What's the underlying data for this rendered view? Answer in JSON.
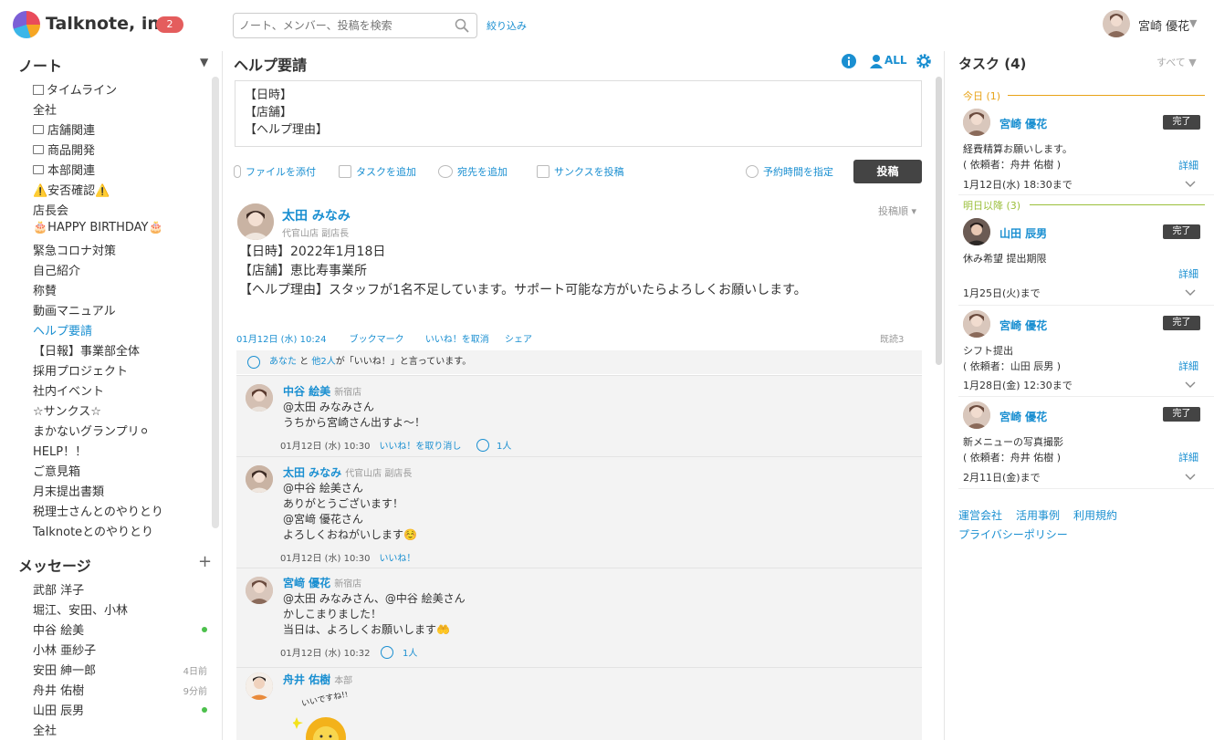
{
  "header": {
    "company": "Talknote, inc.",
    "badge": "2",
    "search_placeholder": "ノート、メンバー、投稿を検索",
    "filter": "絞り込み",
    "user_name": "宮崎 優花",
    "user_caret": "▼"
  },
  "sidebar": {
    "notes_title": "ノート",
    "notes_toggle": "▼",
    "notes": [
      {
        "label": "タイムライン"
      },
      {
        "label": "全社"
      },
      {
        "label": "店舗関連"
      },
      {
        "label": "商品開発"
      },
      {
        "label": "本部関連"
      },
      {
        "label": "⚠️安否確認⚠️"
      },
      {
        "label": "店長会"
      },
      {
        "label": "🎂HAPPY BIRTHDAY🎂"
      },
      {
        "label": "緊急コロナ対策"
      },
      {
        "label": "自己紹介"
      },
      {
        "label": "称賛"
      },
      {
        "label": "動画マニュアル"
      },
      {
        "label": "ヘルプ要請"
      },
      {
        "label": "【日報】事業部全体"
      },
      {
        "label": "採用プロジェクト"
      },
      {
        "label": "社内イベント"
      },
      {
        "label": "☆サンクス☆"
      },
      {
        "label": "まかないグランプリ⚪"
      },
      {
        "label": "HELP！！"
      },
      {
        "label": "ご意見箱"
      },
      {
        "label": "月末提出書類"
      },
      {
        "label": "税理士さんとのやりとり"
      },
      {
        "label": "Talknoteとのやりとり"
      }
    ],
    "messages_title": "メッセージ",
    "messages_add": "+",
    "messages": [
      {
        "label": "武部 洋子",
        "time": ""
      },
      {
        "label": "堀江、安田、小林",
        "time": ""
      },
      {
        "label": "中谷 絵美",
        "time": ""
      },
      {
        "label": "小林 亜紗子",
        "time": ""
      },
      {
        "label": "安田 紳一郎",
        "time": "4日前"
      },
      {
        "label": "舟井 佑樹",
        "time": "9分前"
      },
      {
        "label": "山田 辰男",
        "time": ""
      },
      {
        "label": "全社",
        "time": ""
      }
    ]
  },
  "center": {
    "title": "ヘルプ要請",
    "all_label": "ALL",
    "compose_text": "【日時】\n【店舗】\n【ヘルプ理由】",
    "toolbar": {
      "attach": "ファイルを添付",
      "task": "タスクを追加",
      "recipient": "宛先を追加",
      "thanks": "サンクスを投稿",
      "schedule": "予約時間を指定",
      "post": "投稿"
    },
    "post": {
      "author": "太田 みなみ",
      "author_sub": "代官山店 副店長",
      "order": "投稿順 ▾",
      "body": "【日時】2022年1月18日\n【店舗】恵比寿事業所\n【ヘルプ理由】スタッフが1名不足しています。サポート可能な方がいたらよろしくお願いします。",
      "date": "01月12日 (水) 10:24",
      "bookmark": "ブックマーク",
      "unlike": "いいね！を取消",
      "share": "シェア",
      "read": "既読3",
      "likes_you": "あなた",
      "likes_and": " と ",
      "likes_others": "他2人",
      "likes_tail": "が「いいね！」と言っています。"
    },
    "comments": [
      {
        "author": "中谷 絵美",
        "sub": "新宿店",
        "text": "@太田 みなみさん\nうちから宮崎さん出すよ〜！",
        "date": "01月12日 (水) 10:30",
        "action": "いいね！を取り消し",
        "likes": "1人"
      },
      {
        "author": "太田 みなみ",
        "sub": "代官山店 副店長",
        "text": "@中谷 絵美さん\nありがとうございます！\n@宮﨑 優花さん\nよろしくおねがいします☺️",
        "date": "01月12日 (水) 10:30",
        "action": "いいね！",
        "likes": ""
      },
      {
        "author": "宮﨑 優花",
        "sub": "新宿店",
        "text": "@太田 みなみさん、@中谷 絵美さん\nかしこまりました！\n当日は、よろしくお願いします🤲",
        "date": "01月12日 (水) 10:32",
        "action": "",
        "likes": "1人"
      },
      {
        "author": "舟井 佑樹",
        "sub": "本部",
        "text": "",
        "date": "",
        "action": "",
        "likes": "",
        "sticker_text": "いいですね!!"
      }
    ]
  },
  "tasks": {
    "title": "タスク (4)",
    "filter": "すべて ▼",
    "today_label": "今日 (1)",
    "later_label": "明日以降 (3)",
    "done_label": "完了",
    "detail_label": "詳細",
    "today_color": "#e8a317",
    "later_color": "#9bbf3b",
    "items": [
      {
        "name": "宮崎 優花",
        "desc": "経費精算お願いします。\n( 依頼者：舟井 佑樹 )",
        "due": "1月12日(水) 18:30まで"
      },
      {
        "name": "山田 辰男",
        "desc": "休み希望 提出期限",
        "due": "1月25日(火)まで"
      },
      {
        "name": "宮崎 優花",
        "desc": "シフト提出\n( 依頼者：山田 辰男 )",
        "due": "1月28日(金) 12:30まで"
      },
      {
        "name": "宮崎 優花",
        "desc": "新メニューの写真撮影\n( 依頼者：舟井 佑樹 )",
        "due": "2月11日(金)まで"
      }
    ],
    "footer": {
      "company": "運営会社",
      "examples": "活用事例",
      "terms": "利用規約",
      "privacy": "プライバシーポリシー"
    }
  }
}
